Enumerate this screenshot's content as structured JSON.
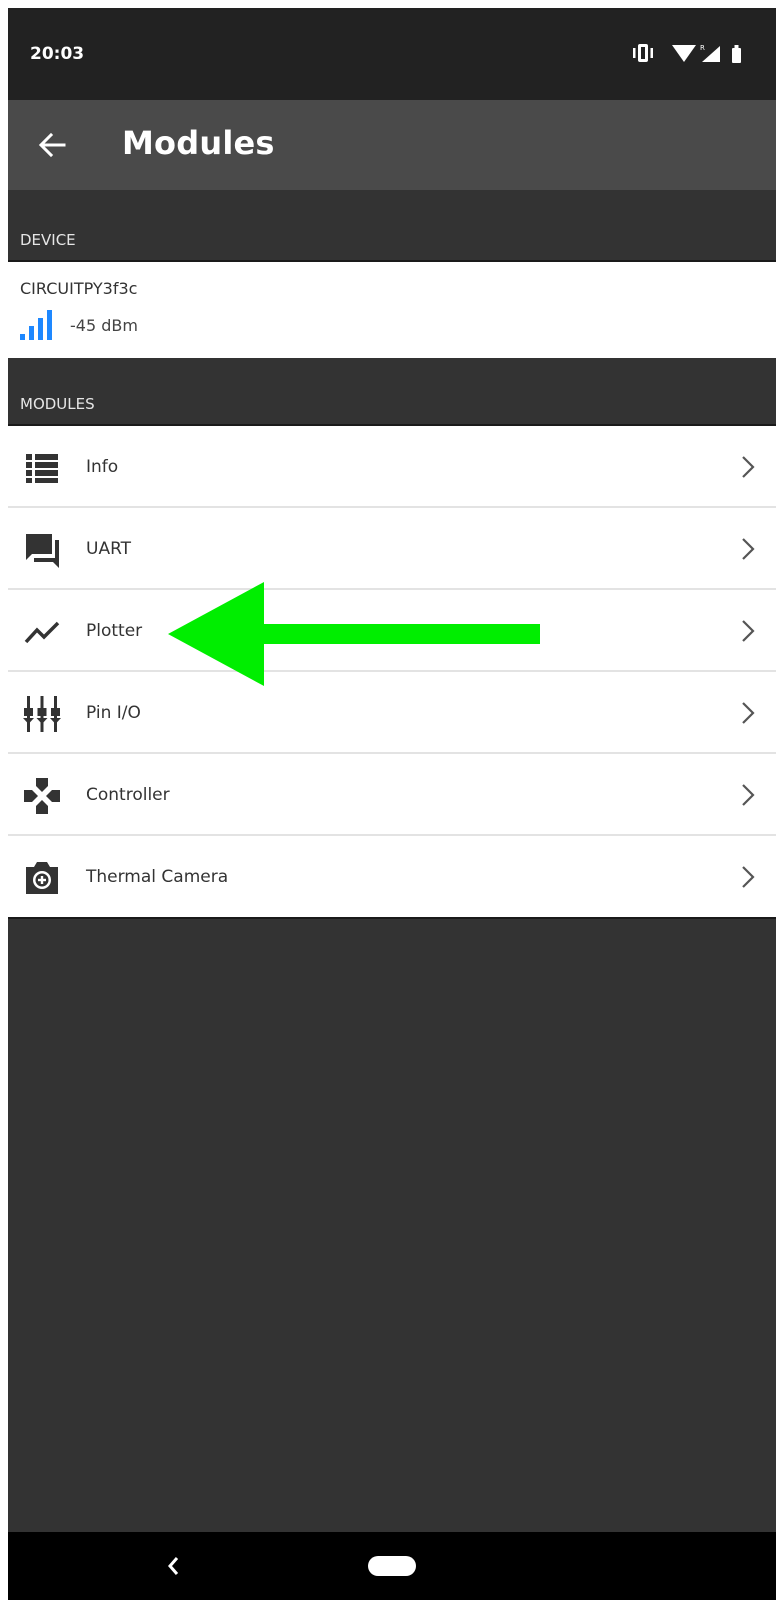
{
  "status_bar": {
    "time": "20:03",
    "icons": [
      "vibrate-icon",
      "wifi-icon",
      "cellular-roaming-icon",
      "battery-icon"
    ]
  },
  "app_bar": {
    "title": "Modules",
    "back_icon": "back-arrow-icon"
  },
  "device_section": {
    "header": "DEVICE",
    "device_name": "CIRCUITPY3f3c",
    "signal": "-45 dBm",
    "signal_icon": "signal-strength-icon"
  },
  "modules_section": {
    "header": "MODULES",
    "items": [
      {
        "label": "Info",
        "icon": "list-icon"
      },
      {
        "label": "UART",
        "icon": "chat-icon"
      },
      {
        "label": "Plotter",
        "icon": "line-chart-icon"
      },
      {
        "label": "Pin I/O",
        "icon": "pins-icon"
      },
      {
        "label": "Controller",
        "icon": "gamepad-icon"
      },
      {
        "label": "Thermal Camera",
        "icon": "camera-icon"
      }
    ]
  },
  "annotation": {
    "shape": "arrow-left",
    "color": "#00ee00",
    "points_to": "Plotter"
  },
  "colors": {
    "status_bar": "#222222",
    "app_bar": "#4a4a4a",
    "background": "#333333",
    "signal_accent": "#1e88ff",
    "arrow": "#00ee00"
  },
  "navigation_bar": {
    "buttons": [
      "back",
      "home"
    ]
  }
}
